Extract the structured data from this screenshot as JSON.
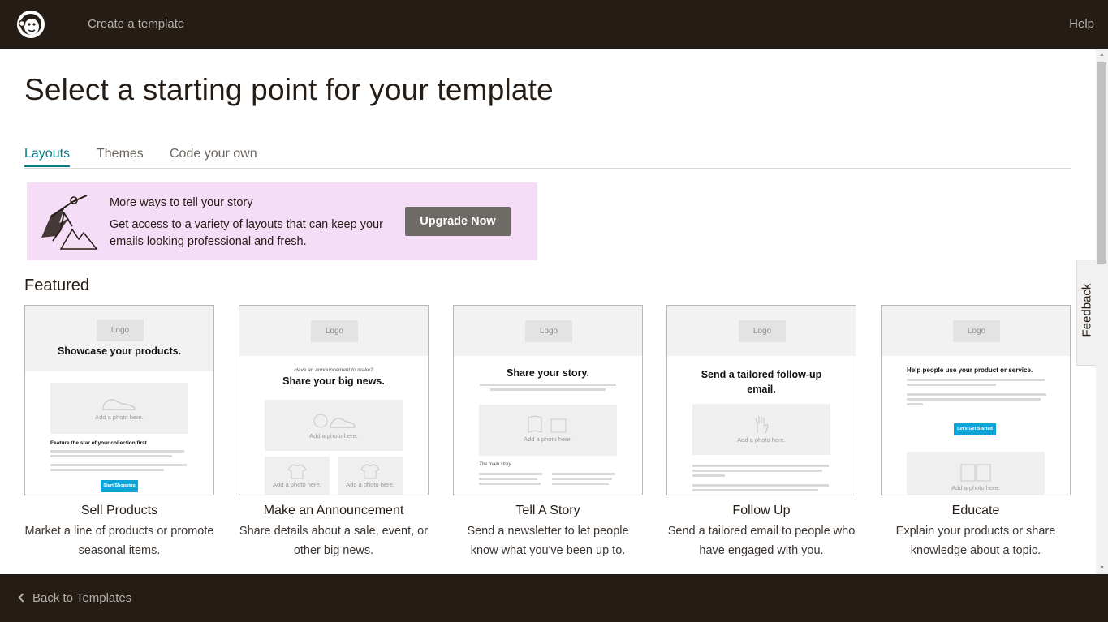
{
  "header": {
    "title": "Create a template",
    "help": "Help"
  },
  "page": {
    "heading": "Select a starting point for your template"
  },
  "tabs": [
    {
      "label": "Layouts",
      "active": true
    },
    {
      "label": "Themes",
      "active": false
    },
    {
      "label": "Code your own",
      "active": false
    }
  ],
  "promo": {
    "title": "More ways to tell your story",
    "body": "Get access to a variety of layouts that can keep your emails looking professional and fresh.",
    "button": "Upgrade Now",
    "background": "#f6ddf7"
  },
  "featured_heading": "Featured",
  "cards": [
    {
      "name": "Sell Products",
      "description": "Market a line of products or promote seasonal items.",
      "thumb": {
        "logo": "Logo",
        "headline": "Showcase your products.",
        "photo": "Add a photo here.",
        "subhead": "Feature the star of your collection first.",
        "button": "Start Shopping"
      }
    },
    {
      "name": "Make an Announcement",
      "description": "Share details about a sale, event, or other big news.",
      "thumb": {
        "logo": "Logo",
        "kicker": "Have an announcement to make?",
        "headline": "Share your big news.",
        "photo": "Add a photo here.",
        "photo_small": "Add a photo here."
      }
    },
    {
      "name": "Tell A Story",
      "description": "Send a newsletter to let people know what you've been up to.",
      "thumb": {
        "logo": "Logo",
        "headline": "Share your story.",
        "photo": "Add a photo here.",
        "kicker": "The main story"
      }
    },
    {
      "name": "Follow Up",
      "description": "Send a tailored email to people who have engaged with you.",
      "thumb": {
        "logo": "Logo",
        "headline": "Send a tailored follow-up email.",
        "photo": "Add a photo here."
      }
    },
    {
      "name": "Educate",
      "description": "Explain your products or share knowledge about a topic.",
      "thumb": {
        "logo": "Logo",
        "headline": "Help people use your product or service.",
        "button": "Let's Get Started",
        "photo": "Add a photo here."
      }
    }
  ],
  "feedback": "Feedback",
  "footer": {
    "back": "Back to Templates"
  },
  "colors": {
    "dark": "#241c15",
    "accent": "#007c89",
    "button_gray": "#6e6a66",
    "cta_blue": "#0fa4d8"
  }
}
